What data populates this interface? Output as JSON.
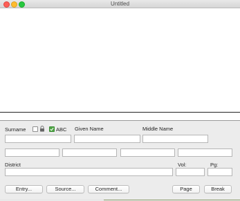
{
  "window": {
    "title": "Untitled"
  },
  "form": {
    "surname_label": "Surname",
    "abc_label": "ABC",
    "abc_checked": true,
    "lock_checked": false,
    "given_name_label": "Given Name",
    "middle_name_label": "Middle Name",
    "district_label": "District",
    "vol_label": "Vol:",
    "pg_label": "Pg:",
    "surname_value": "",
    "given_name_value": "",
    "middle_name_value": "",
    "extra_fields": [
      "",
      "",
      "",
      ""
    ],
    "district_value": "",
    "vol_value": "",
    "pg_value": ""
  },
  "buttons": {
    "entry": "Entry...",
    "source": "Source...",
    "comment": "Comment...",
    "page": "Page",
    "break": "Break"
  },
  "icons": {
    "close": "close-icon",
    "minimize": "minimize-icon",
    "maximize": "maximize-icon",
    "lock": "lock-icon",
    "checkmark": "checkmark-icon"
  }
}
